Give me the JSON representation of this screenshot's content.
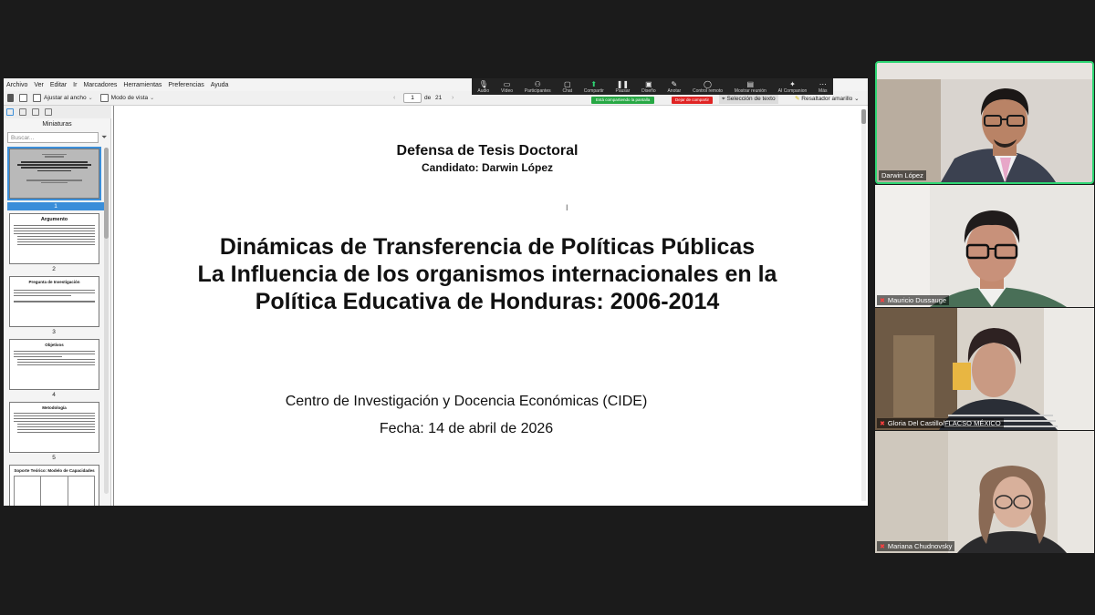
{
  "viewer": {
    "menu": [
      "Archivo",
      "Ver",
      "Editar",
      "Ir",
      "Marcadores",
      "Herramientas",
      "Preferencias",
      "Ayuda"
    ],
    "toolbar": {
      "fit_label": "Ajustar al ancho",
      "view_mode_label": "Modo de vista",
      "page_current": "1",
      "page_of": "de",
      "page_total": "21",
      "selection_label": "Selección de texto",
      "highlighter_label": "Resaltador amarillo"
    },
    "sidebar": {
      "title": "Miniaturas",
      "search_placeholder": "Buscar...",
      "thumbs": [
        {
          "num": "1",
          "title": ""
        },
        {
          "num": "2",
          "title": "Argumento"
        },
        {
          "num": "3",
          "title": "Pregunta de Investigación"
        },
        {
          "num": "4",
          "title": "Objetivos"
        },
        {
          "num": "5",
          "title": "Metodología"
        },
        {
          "num": "",
          "title": "Soporte Teórico: Modelo de Capacidades"
        }
      ]
    },
    "page": {
      "header_line1": "Defensa de Tesis Doctoral",
      "header_line2": "Candidato: Darwin López",
      "title_line1": "Dinámicas de Transferencia de Políticas Públicas",
      "title_line2": "La Influencia de los organismos internacionales en la",
      "title_line3": "Política Educativa de Honduras: 2006-2014",
      "institution": "Centro de Investigación y Docencia Económicas (CIDE)",
      "date": "Fecha: 14 de abril de 2026"
    }
  },
  "meeting": {
    "toolbar": [
      {
        "icon": "microphone-icon",
        "label": "Audio"
      },
      {
        "icon": "video-icon",
        "label": "Vídeo"
      },
      {
        "icon": "participants-icon",
        "label": "Participantes"
      },
      {
        "icon": "chat-icon",
        "label": "Chat"
      },
      {
        "icon": "share-icon",
        "label": "Compartir"
      },
      {
        "icon": "pause-icon",
        "label": "Pausar"
      },
      {
        "icon": "design-icon",
        "label": "Diseño"
      },
      {
        "icon": "annotate-icon",
        "label": "Anotar"
      },
      {
        "icon": "remote-control-icon",
        "label": "Control remoto"
      },
      {
        "icon": "show-meeting-icon",
        "label": "Mostrar reunión"
      },
      {
        "icon": "ai-companion-icon",
        "label": "AI Companion"
      },
      {
        "icon": "more-icon",
        "label": "Más"
      }
    ],
    "share_status": "Está compartiendo la pantalla",
    "stop_share": "Dejar de compartir",
    "accent": "#2ed573",
    "participants": [
      {
        "name": "Darwin López",
        "muted": false,
        "active": true
      },
      {
        "name": "Mauricio Dussauge",
        "muted": true,
        "active": false
      },
      {
        "name": "Gloria Del Castillo/FLACSO MÉXICO",
        "muted": true,
        "active": false
      },
      {
        "name": "Mariana Chudnovsky",
        "muted": true,
        "active": false
      }
    ]
  }
}
